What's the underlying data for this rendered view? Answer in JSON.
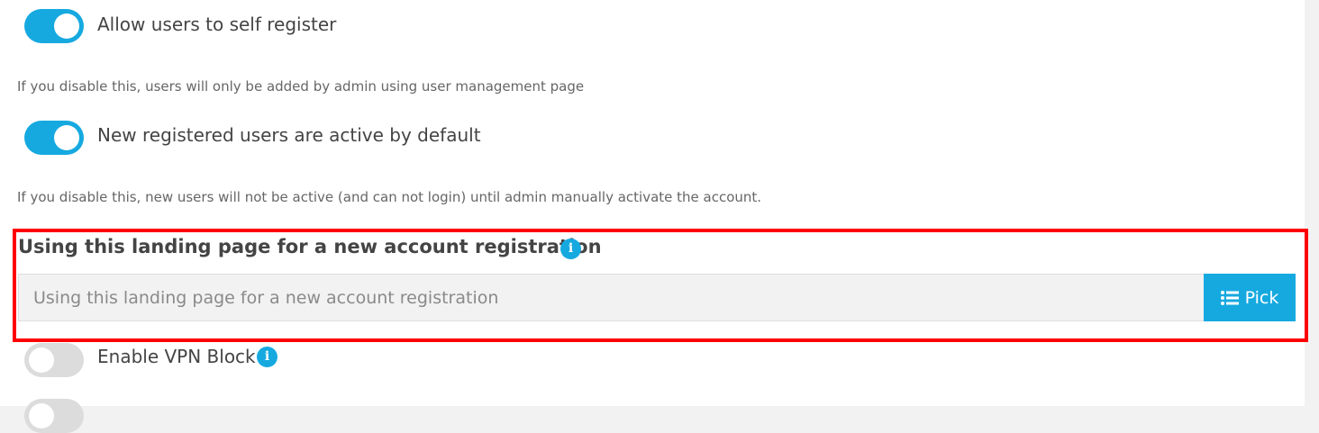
{
  "settings": {
    "self_register": {
      "label": "Allow users to self register",
      "help": "If you disable this, users will only be added by admin using user management page",
      "enabled": true
    },
    "active_by_default": {
      "label": "New registered users are active by default",
      "help": "If you disable this, new users will not be active (and can not login) until admin manually activate the account.",
      "enabled": true
    },
    "landing_page": {
      "label": "Using this landing page for a new account registration",
      "placeholder": "Using this landing page for a new account registration",
      "value": "",
      "pick_label": "Pick",
      "info_icon": "info-icon",
      "pick_icon": "list-icon"
    },
    "vpn_block": {
      "label": "Enable VPN Block",
      "enabled": false,
      "info_icon": "info-icon"
    }
  },
  "colors": {
    "accent": "#16a9e0",
    "highlight": "#ff0000",
    "toggle_off": "#dcdcdc"
  }
}
